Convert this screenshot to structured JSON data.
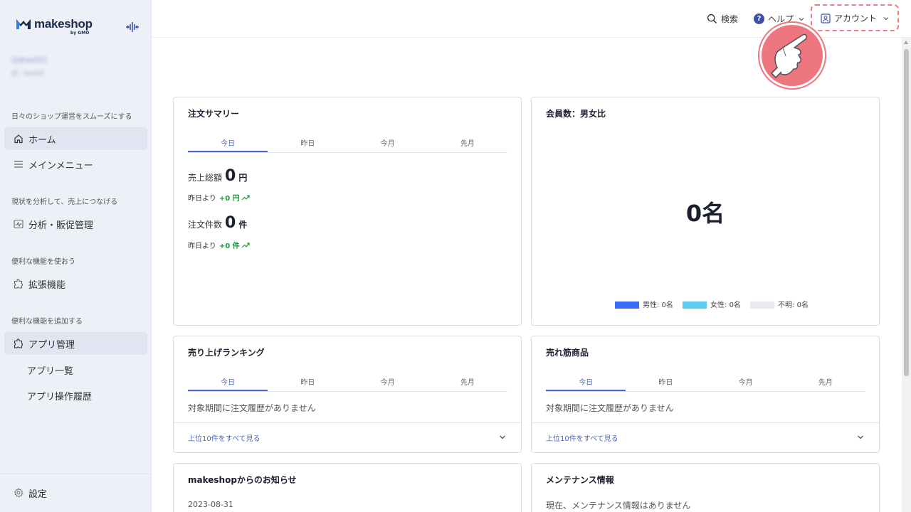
{
  "sidebar": {
    "logo_text": "makeshop",
    "logo_sub": "by GMO",
    "shop_name": "Qdtest01",
    "shop_id": "ID : test01",
    "sections": {
      "daily": "日々のショップ運営をスムーズにする",
      "analyze": "現状を分析して、売上につなげる",
      "useful": "便利な機能を使おう",
      "add": "便利な機能を追加する"
    },
    "items": {
      "home": "ホーム",
      "main_menu": "メインメニュー",
      "analytics": "分析・販促管理",
      "extensions": "拡張機能",
      "apps": "アプリ管理",
      "app_list": "アプリ一覧",
      "app_history": "アプリ操作履歴",
      "settings": "設定"
    }
  },
  "header": {
    "search": "検索",
    "help": "ヘルプ",
    "account": "アカウント"
  },
  "tabs": [
    "今日",
    "昨日",
    "今月",
    "先月"
  ],
  "order_summary": {
    "title": "注文サマリー",
    "sales_label": "売上総額",
    "sales_value": "0",
    "sales_unit": "円",
    "cmp_label": "昨日より",
    "sales_delta": "+0 円",
    "orders_label": "注文件数",
    "orders_value": "0",
    "orders_unit": "件",
    "orders_delta": "+0 件"
  },
  "members": {
    "title": "会員数：男女比",
    "total": "0名",
    "legend": [
      {
        "label": "男性: 0名",
        "color": "#3b6cf5"
      },
      {
        "label": "女性: 0名",
        "color": "#5bcdf5"
      },
      {
        "label": "不明: 0名",
        "color": "#e8eaf0"
      }
    ]
  },
  "ranking": {
    "title": "売り上げランキング",
    "empty": "対象期間に注文履歴がありません",
    "link": "上位10件をすべて見る"
  },
  "bestsellers": {
    "title": "売れ筋商品",
    "empty": "対象期間に注文履歴がありません",
    "link": "上位10件をすべて見る"
  },
  "news": {
    "title": "makeshopからのお知らせ",
    "date": "2023-08-31"
  },
  "maintenance": {
    "title": "メンテナンス情報",
    "message": "現在、メンテナンス情報はありません"
  },
  "colors": {
    "accent": "#4a66c9",
    "highlight": "#ee7680",
    "positive": "#1a9a3a"
  }
}
